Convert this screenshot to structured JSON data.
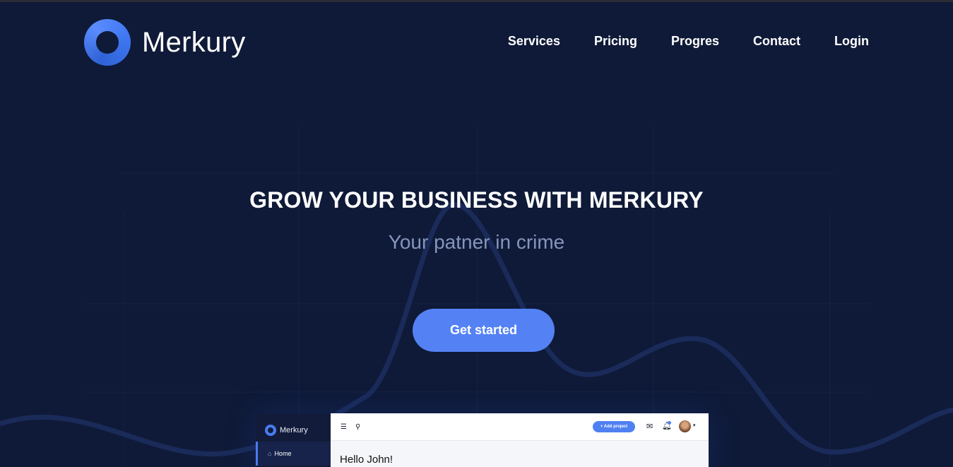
{
  "brand": {
    "name": "Merkury"
  },
  "nav": {
    "items": [
      "Services",
      "Pricing",
      "Progres",
      "Contact",
      "Login"
    ]
  },
  "hero": {
    "title": "GROW YOUR BUSINESS WITH MERKURY",
    "subtitle": "Your patner in crime",
    "cta_label": "Get started"
  },
  "mockup": {
    "brand": "Merkury",
    "sidebar_item": "Home",
    "add_button": "+ Add project",
    "greeting": "Hello John!"
  },
  "colors": {
    "background": "#0f1a38",
    "accent": "#5482f5",
    "subtitle": "#8595bb"
  }
}
